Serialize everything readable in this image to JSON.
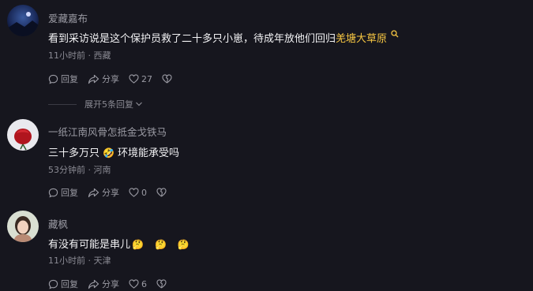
{
  "comments": [
    {
      "username": "爱藏嘉布",
      "text_main": "看到采访说是这个保护员救了二十多只小崽，待成年放他们回归",
      "text_link": "羌塘大草原",
      "time": "11小时前",
      "location": "西藏",
      "reply_label": "回复",
      "share_label": "分享",
      "like_count": "27"
    },
    {
      "username": "一纸江南风骨怎抵金戈铁马",
      "text_part1": "三十多万只",
      "emoji": "🤣",
      "text_part2": "环境能承受吗",
      "time": "53分钟前",
      "location": "河南",
      "reply_label": "回复",
      "share_label": "分享",
      "like_count": "0"
    },
    {
      "username": "藏枫",
      "text_main": "有没有可能是串儿",
      "emoji1": "🤔",
      "emoji2": "🤔",
      "emoji3": "🤔",
      "time": "11小时前",
      "location": "天津",
      "reply_label": "回复",
      "share_label": "分享",
      "like_count": "6"
    }
  ],
  "expand_replies": "展开5条回复",
  "separator": "·",
  "colors": {
    "background": "#16161e",
    "highlight": "#f5c542"
  }
}
